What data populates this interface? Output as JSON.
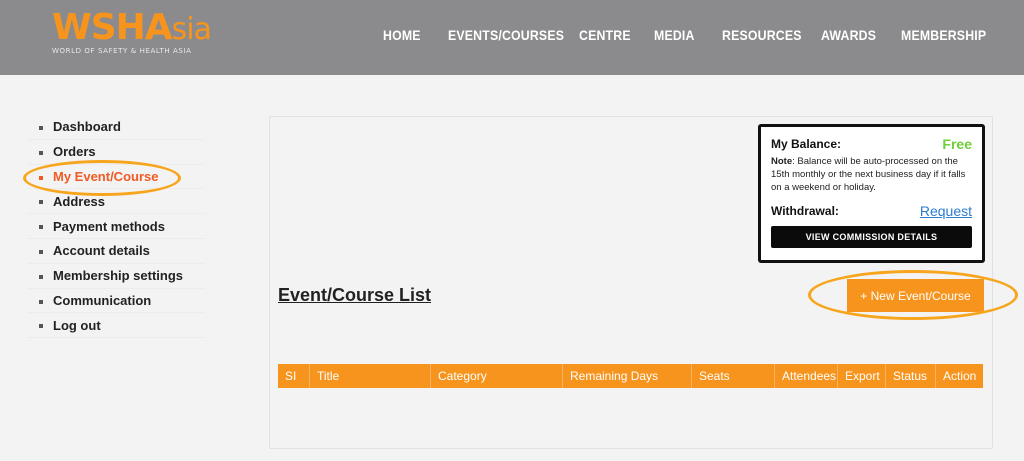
{
  "logo": {
    "main": "WSHA",
    "sub": "sia",
    "tagline": "WORLD OF SAFETY & HEALTH ASIA"
  },
  "nav": {
    "items": [
      "HOME",
      "EVENTS/COURSES",
      "CENTRE",
      "MEDIA",
      "RESOURCES",
      "AWARDS",
      "MEMBERSHIP"
    ]
  },
  "sidebar": {
    "items": [
      {
        "label": "Dashboard"
      },
      {
        "label": "Orders"
      },
      {
        "label": "My Event/Course",
        "active": true
      },
      {
        "label": "Address"
      },
      {
        "label": "Payment methods"
      },
      {
        "label": "Account details"
      },
      {
        "label": "Membership settings"
      },
      {
        "label": "Communication"
      },
      {
        "label": "Log out"
      }
    ]
  },
  "balance": {
    "label": "My Balance:",
    "value": "Free",
    "note_bold": "Note",
    "note_text": ": Balance will be auto-processed on the 15th monthly or the next business day if it falls on a weekend or holiday.",
    "withdrawal_label": "Withdrawal:",
    "request_link": "Request",
    "button_label": "VIEW COMMISSION DETAILS"
  },
  "main": {
    "title": "Event/Course List",
    "new_button": "+ New Event/Course"
  },
  "table": {
    "columns": [
      "SI",
      "Title",
      "Category",
      "Remaining Days",
      "Seats",
      "Attendees",
      "Export",
      "Status",
      "Action"
    ]
  },
  "colors": {
    "accent": "#f7941d",
    "active": "#f15a24",
    "header_bg": "#8b8b8d",
    "free": "#6fcf3b",
    "link": "#2a7dd1"
  }
}
